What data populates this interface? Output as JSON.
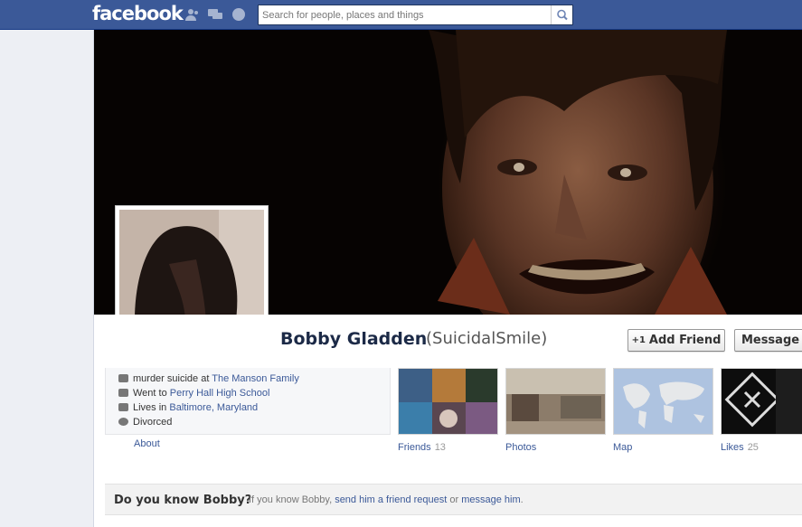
{
  "topbar": {
    "logo": "facebook",
    "search_placeholder": "Search for people, places and things",
    "jewels": [
      "friend-requests-icon",
      "messages-icon",
      "notifications-icon"
    ]
  },
  "profile": {
    "name": "Bobby Gladden",
    "alternate_name": "(SuicidalSmile)",
    "add_friend_label": "Add Friend",
    "add_friend_prefix": "+1",
    "message_label": "Message"
  },
  "info": {
    "work_prefix": "murder suicide at",
    "work_link": "The Manson Family",
    "school_prefix": "Went to",
    "school_link": "Perry Hall High School",
    "lives_prefix": "Lives in",
    "lives_link": "Baltimore, Maryland",
    "relationship": "Divorced",
    "about_label": "About"
  },
  "tiles": [
    {
      "label": "Friends",
      "count": "13"
    },
    {
      "label": "Photos",
      "count": ""
    },
    {
      "label": "Map",
      "count": ""
    },
    {
      "label": "Likes",
      "count": "25"
    }
  ],
  "know": {
    "title": "Do you know Bobby?",
    "text_prefix": "If you know Bobby,",
    "link1": "send him a friend request",
    "middle": "or",
    "link2": "message him",
    "suffix": "."
  },
  "colors": {
    "brand": "#3b5998",
    "brand_dark": "#133783",
    "link": "#3b5998"
  }
}
